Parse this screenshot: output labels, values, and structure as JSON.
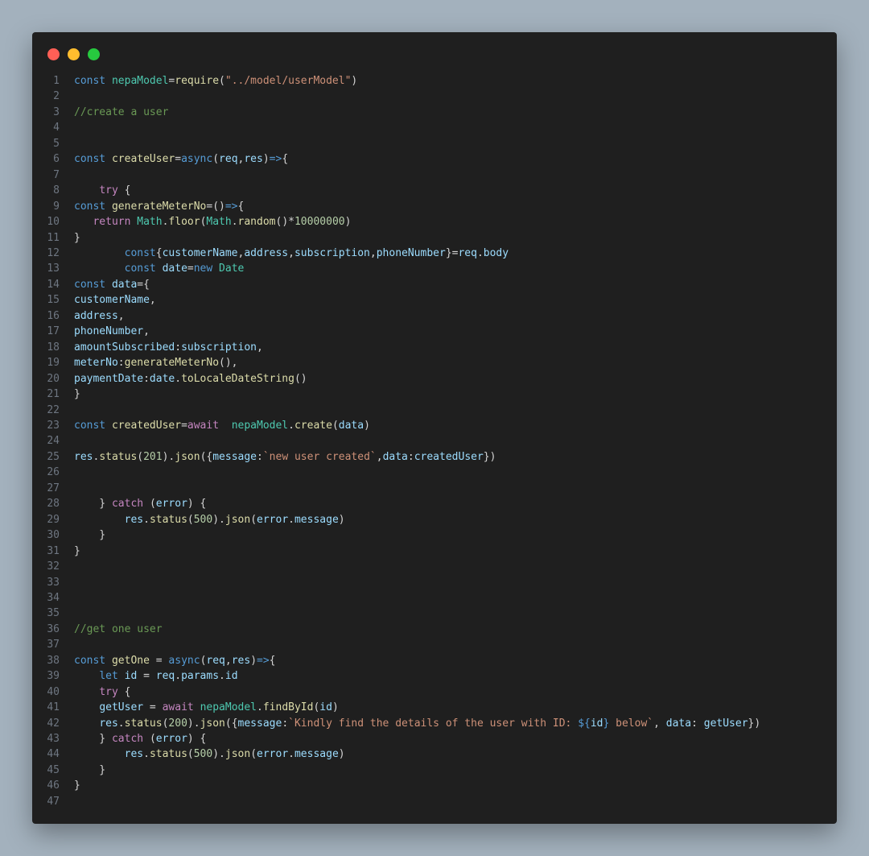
{
  "window": {
    "controls": [
      "close",
      "minimize",
      "maximize"
    ]
  },
  "colors": {
    "background": "#a3b1bd",
    "editor_bg": "#1f1f1f",
    "keyword": "#569cd6",
    "control": "#c586c0",
    "function": "#dcdcaa",
    "variable": "#9cdcfe",
    "class": "#4ec9b0",
    "string": "#ce9178",
    "number": "#b5cea8",
    "comment": "#6a9955"
  },
  "code": {
    "lines": [
      [
        [
          "k",
          "const "
        ],
        [
          "cls",
          "nepaModel"
        ],
        [
          "p",
          "="
        ],
        [
          "fn",
          "require"
        ],
        [
          "p",
          "("
        ],
        [
          "s",
          "\"../model/userModel\""
        ],
        [
          "p",
          ")"
        ]
      ],
      [],
      [
        [
          "cm",
          "//create a user"
        ]
      ],
      [],
      [],
      [
        [
          "k",
          "const "
        ],
        [
          "fn",
          "createUser"
        ],
        [
          "p",
          "="
        ],
        [
          "k",
          "async"
        ],
        [
          "p",
          "("
        ],
        [
          "v",
          "req"
        ],
        [
          "p",
          ","
        ],
        [
          "v",
          "res"
        ],
        [
          "p",
          ")"
        ],
        [
          "k",
          "=>"
        ],
        [
          "p",
          "{"
        ]
      ],
      [],
      [
        [
          "p",
          "    "
        ],
        [
          "c",
          "try "
        ],
        [
          "p",
          "{"
        ]
      ],
      [
        [
          "k",
          "const "
        ],
        [
          "fn",
          "generateMeterNo"
        ],
        [
          "p",
          "="
        ],
        [
          "p",
          "()"
        ],
        [
          "k",
          "=>"
        ],
        [
          "p",
          "{"
        ]
      ],
      [
        [
          "p",
          "   "
        ],
        [
          "c",
          "return "
        ],
        [
          "cls",
          "Math"
        ],
        [
          "p",
          "."
        ],
        [
          "fn",
          "floor"
        ],
        [
          "p",
          "("
        ],
        [
          "cls",
          "Math"
        ],
        [
          "p",
          "."
        ],
        [
          "fn",
          "random"
        ],
        [
          "p",
          "()*"
        ],
        [
          "n",
          "10000000"
        ],
        [
          "p",
          ")"
        ]
      ],
      [
        [
          "p",
          "}"
        ]
      ],
      [
        [
          "p",
          "        "
        ],
        [
          "k",
          "const"
        ],
        [
          "p",
          "{"
        ],
        [
          "v",
          "customerName"
        ],
        [
          "p",
          ","
        ],
        [
          "v",
          "address"
        ],
        [
          "p",
          ","
        ],
        [
          "v",
          "subscription"
        ],
        [
          "p",
          ","
        ],
        [
          "v",
          "phoneNumber"
        ],
        [
          "p",
          "}="
        ],
        [
          "v",
          "req"
        ],
        [
          "p",
          "."
        ],
        [
          "v",
          "body"
        ]
      ],
      [
        [
          "p",
          "        "
        ],
        [
          "k",
          "const "
        ],
        [
          "v",
          "date"
        ],
        [
          "p",
          "="
        ],
        [
          "k",
          "new "
        ],
        [
          "cls",
          "Date"
        ]
      ],
      [
        [
          "k",
          "const "
        ],
        [
          "v",
          "data"
        ],
        [
          "p",
          "={"
        ]
      ],
      [
        [
          "v",
          "customerName"
        ],
        [
          "p",
          ","
        ]
      ],
      [
        [
          "v",
          "address"
        ],
        [
          "p",
          ","
        ]
      ],
      [
        [
          "v",
          "phoneNumber"
        ],
        [
          "p",
          ","
        ]
      ],
      [
        [
          "v",
          "amountSubscribed"
        ],
        [
          "p",
          ":"
        ],
        [
          "v",
          "subscription"
        ],
        [
          "p",
          ","
        ]
      ],
      [
        [
          "v",
          "meterNo"
        ],
        [
          "p",
          ":"
        ],
        [
          "fn",
          "generateMeterNo"
        ],
        [
          "p",
          "(),"
        ]
      ],
      [
        [
          "v",
          "paymentDate"
        ],
        [
          "p",
          ":"
        ],
        [
          "v",
          "date"
        ],
        [
          "p",
          "."
        ],
        [
          "fn",
          "toLocaleDateString"
        ],
        [
          "p",
          "()"
        ]
      ],
      [
        [
          "p",
          "}"
        ]
      ],
      [],
      [
        [
          "k",
          "const "
        ],
        [
          "fn",
          "createdUser"
        ],
        [
          "p",
          "="
        ],
        [
          "c",
          "await  "
        ],
        [
          "cls",
          "nepaModel"
        ],
        [
          "p",
          "."
        ],
        [
          "fn",
          "create"
        ],
        [
          "p",
          "("
        ],
        [
          "v",
          "data"
        ],
        [
          "p",
          ")"
        ]
      ],
      [],
      [
        [
          "v",
          "res"
        ],
        [
          "p",
          "."
        ],
        [
          "fn",
          "status"
        ],
        [
          "p",
          "("
        ],
        [
          "n",
          "201"
        ],
        [
          "p",
          ")."
        ],
        [
          "fn",
          "json"
        ],
        [
          "p",
          "({"
        ],
        [
          "v",
          "message"
        ],
        [
          "p",
          ":"
        ],
        [
          "s",
          "`new user created`"
        ],
        [
          "p",
          ","
        ],
        [
          "v",
          "data"
        ],
        [
          "p",
          ":"
        ],
        [
          "v",
          "createdUser"
        ],
        [
          "p",
          "})"
        ]
      ],
      [],
      [],
      [
        [
          "p",
          "    } "
        ],
        [
          "c",
          "catch "
        ],
        [
          "p",
          "("
        ],
        [
          "v",
          "error"
        ],
        [
          "p",
          ") {"
        ]
      ],
      [
        [
          "p",
          "        "
        ],
        [
          "v",
          "res"
        ],
        [
          "p",
          "."
        ],
        [
          "fn",
          "status"
        ],
        [
          "p",
          "("
        ],
        [
          "n",
          "500"
        ],
        [
          "p",
          ")."
        ],
        [
          "fn",
          "json"
        ],
        [
          "p",
          "("
        ],
        [
          "v",
          "error"
        ],
        [
          "p",
          "."
        ],
        [
          "v",
          "message"
        ],
        [
          "p",
          ")"
        ]
      ],
      [
        [
          "p",
          "    }"
        ]
      ],
      [
        [
          "p",
          "}"
        ]
      ],
      [],
      [],
      [],
      [],
      [
        [
          "cm",
          "//get one user"
        ]
      ],
      [],
      [
        [
          "k",
          "const "
        ],
        [
          "fn",
          "getOne"
        ],
        [
          "p",
          " = "
        ],
        [
          "k",
          "async"
        ],
        [
          "p",
          "("
        ],
        [
          "v",
          "req"
        ],
        [
          "p",
          ","
        ],
        [
          "v",
          "res"
        ],
        [
          "p",
          ")"
        ],
        [
          "k",
          "=>"
        ],
        [
          "p",
          "{"
        ]
      ],
      [
        [
          "p",
          "    "
        ],
        [
          "k",
          "let "
        ],
        [
          "v",
          "id"
        ],
        [
          "p",
          " = "
        ],
        [
          "v",
          "req"
        ],
        [
          "p",
          "."
        ],
        [
          "v",
          "params"
        ],
        [
          "p",
          "."
        ],
        [
          "v",
          "id"
        ]
      ],
      [
        [
          "p",
          "    "
        ],
        [
          "c",
          "try "
        ],
        [
          "p",
          "{"
        ]
      ],
      [
        [
          "p",
          "    "
        ],
        [
          "v",
          "getUser"
        ],
        [
          "p",
          " = "
        ],
        [
          "c",
          "await "
        ],
        [
          "cls",
          "nepaModel"
        ],
        [
          "p",
          "."
        ],
        [
          "fn",
          "findById"
        ],
        [
          "p",
          "("
        ],
        [
          "v",
          "id"
        ],
        [
          "p",
          ")"
        ]
      ],
      [
        [
          "p",
          "    "
        ],
        [
          "v",
          "res"
        ],
        [
          "p",
          "."
        ],
        [
          "fn",
          "status"
        ],
        [
          "p",
          "("
        ],
        [
          "n",
          "200"
        ],
        [
          "p",
          ")."
        ],
        [
          "fn",
          "json"
        ],
        [
          "p",
          "({"
        ],
        [
          "v",
          "message"
        ],
        [
          "p",
          ":"
        ],
        [
          "s",
          "`Kindly find the details of the user with ID: "
        ],
        [
          "k",
          "${"
        ],
        [
          "v",
          "id"
        ],
        [
          "k",
          "}"
        ],
        [
          "s",
          " below`"
        ],
        [
          "p",
          ", "
        ],
        [
          "v",
          "data"
        ],
        [
          "p",
          ": "
        ],
        [
          "v",
          "getUser"
        ],
        [
          "p",
          "})"
        ]
      ],
      [
        [
          "p",
          "    } "
        ],
        [
          "c",
          "catch "
        ],
        [
          "p",
          "("
        ],
        [
          "v",
          "error"
        ],
        [
          "p",
          ") {"
        ]
      ],
      [
        [
          "p",
          "        "
        ],
        [
          "v",
          "res"
        ],
        [
          "p",
          "."
        ],
        [
          "fn",
          "status"
        ],
        [
          "p",
          "("
        ],
        [
          "n",
          "500"
        ],
        [
          "p",
          ")."
        ],
        [
          "fn",
          "json"
        ],
        [
          "p",
          "("
        ],
        [
          "v",
          "error"
        ],
        [
          "p",
          "."
        ],
        [
          "v",
          "message"
        ],
        [
          "p",
          ")"
        ]
      ],
      [
        [
          "p",
          "    }"
        ]
      ],
      [
        [
          "p",
          "}"
        ]
      ],
      []
    ]
  }
}
